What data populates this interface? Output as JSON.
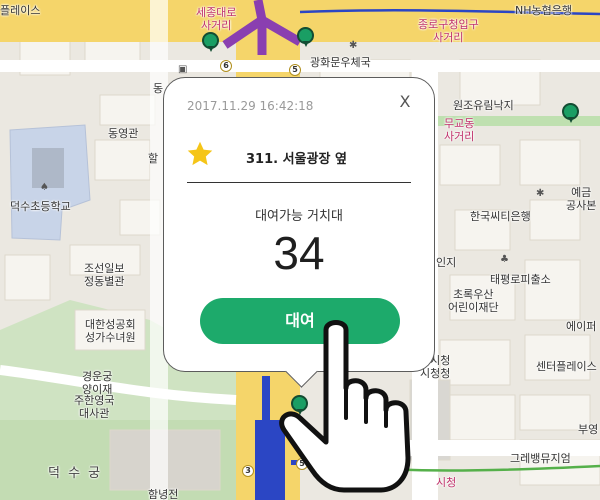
{
  "map": {
    "labels": {
      "top_left": "플레이스",
      "sejongno": "세종대로\n사거리",
      "nh_bank": "NH농협은행",
      "jongno": "종로구청입구\n사거리",
      "gwanghwamun_post": "광화문우체국",
      "dong_top": "동",
      "wonjo": "원조유림낙지",
      "donggyeongwon": "동영관",
      "mugyodong": "무교동\n사거리",
      "hal": "할",
      "yegeum": "예금\n공사본",
      "deoksu_school": "덕수초등학교",
      "hankook_citi": "한국씨티은행",
      "jaeil": "조선일보\n정동별관",
      "injitxt": "인지",
      "taepyeong": "태평로피출소",
      "chorok": "초록우산\n어린이재단",
      "epi": "에이퍼",
      "anglican": "대한성공회\n성가수녀원",
      "center_place": "센터플레이스",
      "seoul_hall": "울시청\n시청청",
      "gyeongun": "경운궁\n양이재",
      "us_embassy": "주한영국\n대사관",
      "buyeong": "부영",
      "grevangmu": "그레뱅뮤지엄",
      "deoksugung": "덕 수 궁",
      "hamnyeongjeon": "함녕전",
      "sicheong": "시청"
    },
    "station_numbers": [
      "6",
      "5",
      "3",
      "5"
    ]
  },
  "popup": {
    "timestamp": "2017.11.29 16:42:18",
    "close_label": "X",
    "station_name": "311. 서울광장 옆",
    "available_label": "대여가능 거치대",
    "available_count": "34",
    "rent_button": "대여"
  },
  "colors": {
    "accent": "#1daa6b",
    "star": "#f5c518",
    "subway_line2": "#2f7f3f",
    "subway_line5": "#8a3fb0",
    "subway_line1": "#2b46c4"
  }
}
